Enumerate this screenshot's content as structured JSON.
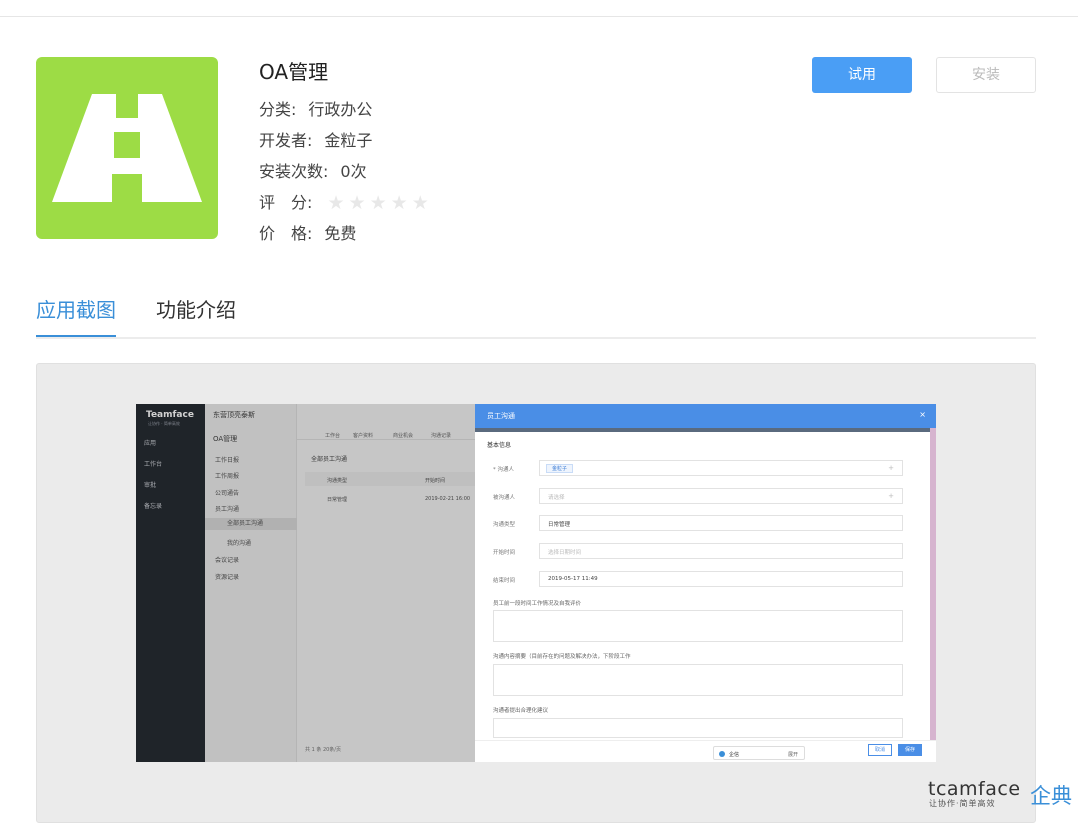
{
  "app": {
    "title": "OA管理",
    "category_label": "分类:",
    "category_value": "行政办公",
    "developer_label": "开发者:",
    "developer_value": "金粒子",
    "installs_label": "安装次数:",
    "installs_value": "0次",
    "rating_label": "评　分:",
    "rating_stars": 0,
    "rating_max": 5,
    "price_label": "价　格:",
    "price_value": "免费",
    "icon": "road-icon",
    "icon_bg_color": "#9ddc45"
  },
  "buttons": {
    "trial": "试用",
    "install": "安装"
  },
  "tabs": [
    {
      "label": "应用截图",
      "active": true
    },
    {
      "label": "功能介绍",
      "active": false
    }
  ],
  "screenshot": {
    "logo": "Teamface",
    "logo_sub": "让协作 · 简单高效",
    "sidebar_items": [
      "应用",
      "工作台",
      "审批",
      "备忘录"
    ],
    "company": "东营顶亮泰斯",
    "menu_title": "OA管理",
    "menu_items": [
      "工作日报",
      "工作周报",
      "公司通告",
      "员工沟通",
      "全部员工沟通",
      "我的沟通",
      "会议记录",
      "资源记录"
    ],
    "list_tabs": [
      "工作台",
      "客户资料",
      "商业机会",
      "沟通记录"
    ],
    "list_title": "全部员工沟通",
    "col_type": "沟通类型",
    "col_start": "开始时间",
    "row_type": "日常管理",
    "row_start": "2019-02-21 16:00",
    "footer": "共 1 条  20条/页",
    "dialog_title": "员工沟通",
    "dialog_close": "×",
    "section": "基本信息",
    "field_initiator_label": "* 沟通人",
    "field_initiator_value": "金粒子",
    "field_target_label": "被沟通人",
    "field_target_placeholder": "请选择",
    "field_type_label": "沟通类型",
    "field_type_value": "日常管理",
    "field_start_label": "开始时间",
    "field_start_placeholder": "选择日期时间",
    "field_end_label": "结束时间",
    "field_end_value": "2019-05-17 11:49",
    "text1": "员工前一段时间工作情况及自我评价",
    "text2": "沟通内容摘要（目前存在的问题及解决办法，下阶段工作",
    "text3": "沟通者提出合理化建议",
    "chat_name": "企信",
    "chat_expand": "展开",
    "cancel": "取消",
    "save": "保存"
  },
  "brand": {
    "en": "tcamface",
    "cn": "企典",
    "sub": "让协作·简单高效"
  },
  "colors": {
    "accent": "#3a8fd8",
    "primary_button": "#4a9ef5"
  }
}
